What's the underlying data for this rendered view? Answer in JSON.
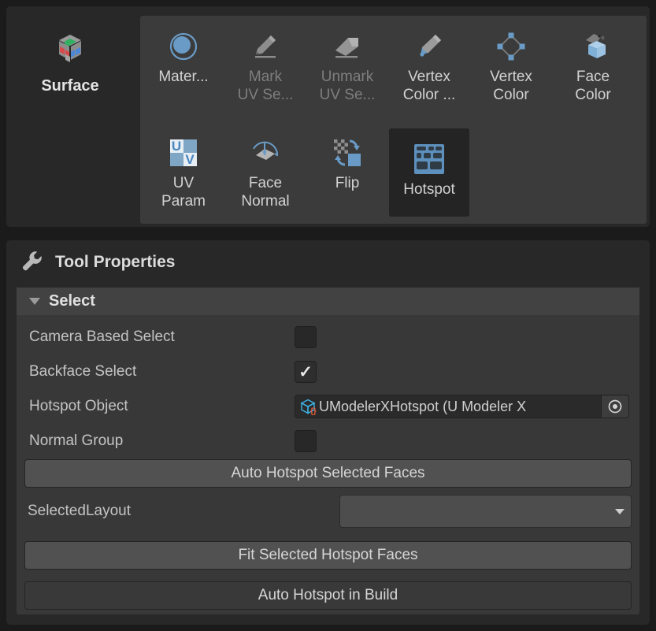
{
  "toolbar": {
    "surface": {
      "label": "Surface",
      "icon": "rubiks-cube-icon"
    },
    "row1": [
      {
        "label": "Mater...",
        "icon": "material-sphere-icon",
        "state": "enabled"
      },
      {
        "label": "Mark\nUV Se...",
        "icon": "pencil-icon",
        "state": "disabled"
      },
      {
        "label": "Unmark\nUV Se...",
        "icon": "eraser-icon",
        "state": "disabled"
      },
      {
        "label": "Vertex\nColor ...",
        "icon": "marker-pen-icon",
        "state": "enabled"
      },
      {
        "label": "Vertex\nColor",
        "icon": "vertex-diamond-icon",
        "state": "enabled"
      },
      {
        "label": "Face\nColor",
        "icon": "paint-bucket-cube-icon",
        "state": "enabled"
      }
    ],
    "row2": [
      {
        "label": "UV\nParam",
        "icon": "uv-grid-icon",
        "state": "enabled"
      },
      {
        "label": "Face\nNormal",
        "icon": "face-normal-icon",
        "state": "enabled"
      },
      {
        "label": "Flip",
        "icon": "flip-icon",
        "state": "enabled"
      },
      {
        "label": "Hotspot",
        "icon": "hotspot-grid-icon",
        "state": "selected"
      }
    ]
  },
  "properties": {
    "header": {
      "title": "Tool Properties",
      "icon": "wrench-icon"
    },
    "section": {
      "title": "Select",
      "expanded": true,
      "icon": "triangle-down-icon"
    },
    "fields": {
      "camera_based_select": {
        "label": "Camera Based Select",
        "checked": false
      },
      "backface_select": {
        "label": "Backface Select",
        "checked": true
      },
      "hotspot_object": {
        "label": "Hotspot Object",
        "value": "UModelerXHotspot (U Modeler X",
        "icon": "prefab-cube-icon",
        "picker_icon": "target-picker-icon"
      },
      "normal_group": {
        "label": "Normal Group",
        "checked": false
      },
      "selected_layout": {
        "label": "SelectedLayout",
        "value": "",
        "arrow_icon": "chevron-down-icon"
      }
    },
    "buttons": {
      "auto_hotspot_selected_faces": "Auto Hotspot Selected Faces",
      "fit_selected_hotspot_faces": "Fit Selected Hotspot Faces",
      "auto_hotspot_in_build": "Auto Hotspot in Build"
    }
  },
  "colors": {
    "window_bg": "#282828",
    "panel_bg": "#3b3b3b",
    "props_body": "#383838",
    "section_header": "#424242",
    "accent_blue": "#6a9bc6",
    "button_normal": "#515151",
    "button_dark": "#393939",
    "text": "#c8c8c8",
    "text_disabled": "#7e7e7e"
  }
}
